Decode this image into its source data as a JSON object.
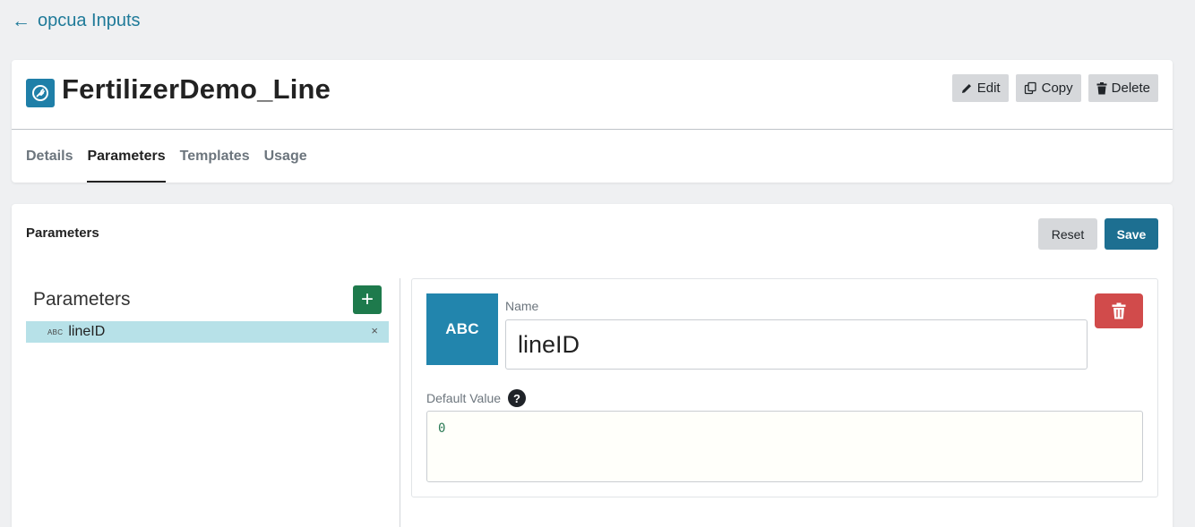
{
  "nav": {
    "back_arrow": "←",
    "back_label": "opcua Inputs"
  },
  "header": {
    "icon": "plug-circle-icon",
    "title": "FertilizerDemo_Line",
    "actions": {
      "edit": "Edit",
      "copy": "Copy",
      "delete": "Delete"
    },
    "tabs": [
      {
        "label": "Details",
        "active": false
      },
      {
        "label": "Parameters",
        "active": true
      },
      {
        "label": "Templates",
        "active": false
      },
      {
        "label": "Usage",
        "active": false
      }
    ]
  },
  "parameters_section": {
    "title": "Parameters",
    "reset_label": "Reset",
    "save_label": "Save",
    "list": {
      "heading": "Parameters",
      "add_label": "+",
      "items": [
        {
          "type": "ABC",
          "name": "lineID",
          "remove": "×"
        }
      ]
    },
    "editor": {
      "type_badge": "ABC",
      "name_label": "Name",
      "name_value": "lineID",
      "default_value_label": "Default Value",
      "help_glyph": "?",
      "default_value": "0"
    }
  },
  "colors": {
    "accent": "#1f7a99",
    "save": "#1d6f91",
    "add": "#1e7a4c",
    "delete": "#d14b4b",
    "selected_row": "#b7e1e8",
    "type_badge": "#2285ad"
  }
}
